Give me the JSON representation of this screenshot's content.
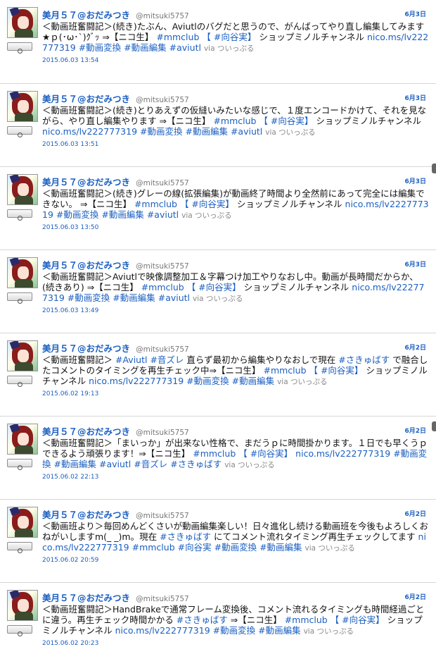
{
  "timeline": {
    "tweets": [
      {
        "name": "美月５７@おだみつき",
        "handle": "@mitsuki5757",
        "date": "6月3日",
        "timestamp": "2015.06.03 13:54",
        "text": "＜動画班奮闘記＞(続き)たぶん、Aviutlのバグだと思うので、がんばってやり直し編集してみます★ｐ(･ω･`)ｸﾞｯ ⇒【ニコ生】",
        "links": [
          "#mmclub",
          "【 #向谷実】"
        ],
        "text2": "ショップミノルチャンネル",
        "links2": [
          "nico.ms/lv222777319",
          "#動画変換",
          "#動画編集",
          "#aviutl"
        ],
        "via": "via ついっぷる"
      },
      {
        "name": "美月５７@おだみつき",
        "handle": "@mitsuki5757",
        "date": "6月3日",
        "timestamp": "2015.06.03 13:51",
        "text": "＜動画班奮闘記＞(続き)とりあえずの仮縫いみたいな感じで、１度エンコードかけて、それを見ながら、やり直し編集やります ⇒【ニコ生】",
        "links": [
          "#mmclub",
          "【 #向谷実】"
        ],
        "text2": "ショップミノルチャンネル",
        "links2": [
          "nico.ms/lv222777319",
          "#動画変換",
          "#動画編集",
          "#aviutl"
        ],
        "via": "via ついっぷる"
      },
      {
        "name": "美月５７@おだみつき",
        "handle": "@mitsuki5757",
        "date": "6月3日",
        "timestamp": "2015.06.03 13:50",
        "text": "＜動画班奮闘記＞(続き)グレーの線(拡張編集)が動画終了時間より全然前にあって完全には編集できない。 ⇒【ニコ生】",
        "links": [
          "#mmclub",
          "【 #向谷実】"
        ],
        "text2": "ショップミノルチャンネル",
        "links2": [
          "nico.ms/lv222777319",
          "#動画変換",
          "#動画編集",
          "#aviutl"
        ],
        "via": "via ついっぷる"
      },
      {
        "name": "美月５７@おだみつき",
        "handle": "@mitsuki5757",
        "date": "6月3日",
        "timestamp": "2015.06.03 13:49",
        "text": "＜動画班奮闘記＞Aviutlで映像調整加工＆字幕つけ加工やりなおし中。動画が長時間だからか、(続きあり) ⇒【ニコ生】",
        "links": [
          "#mmclub",
          "【 #向谷実】"
        ],
        "text2": "ショップミノルチャンネル",
        "links2": [
          "nico.ms/lv222777319",
          "#動画変換",
          "#動画編集",
          "#aviutl"
        ],
        "via": "via ついっぷる"
      },
      {
        "name": "美月５７@おだみつき",
        "handle": "@mitsuki5757",
        "date": "6月2日",
        "timestamp": "2015.06.02 19:13",
        "text": "＜動画班奮闘記＞",
        "links": [
          "#Aviutl",
          "#音ズレ"
        ],
        "text2": "直らず最初から編集やりなおしで現在",
        "links2": [
          "#さきゅばす"
        ],
        "text3": "で融合したコメントのタイミングを再生チェック中⇒【ニコ生】",
        "links3": [
          "#mmclub",
          "【 #向谷実】"
        ],
        "text4": "ショップミノルチャンネル",
        "links4": [
          "nico.ms/lv222777319",
          "#動画変換",
          "#動画編集"
        ],
        "via": "via ついっぷる"
      },
      {
        "name": "美月５７@おだみつき",
        "handle": "@mitsuki5757",
        "date": "6月2日",
        "timestamp": "2015.06.02 22:13",
        "text": "＜動画班奮闘記＞「まいっか」が出来ない性格で、まだうｐに時間掛かります。１日でも早くうｐできるよう頑張ります！⇒【ニコ生】",
        "links": [
          "#mmclub",
          "【 #向谷実】"
        ],
        "text2": "",
        "links2": [
          "nico.ms/lv222777319",
          "#動画変換",
          "#動画編集",
          "#aviutl",
          "#音ズレ",
          "#さきゅばす"
        ],
        "via": "via ついっぷる"
      },
      {
        "name": "美月５７@おだみつき",
        "handle": "@mitsuki5757",
        "date": "6月2日",
        "timestamp": "2015.06.02 20:59",
        "text": "＜動画班より＞毎回めんどくさいが動画編集楽しい！日々進化し続ける動画班を今後もよろしくおねがいしますm(_ _)m。現在",
        "links": [
          "#さきゅばす"
        ],
        "text2": "にてコメント流れタイミング再生チェックしてます",
        "links2": [
          "nico.ms/lv222777319",
          "#mmclub",
          "#向谷実",
          "#動画変換",
          "#動画編集"
        ],
        "via": "via ついっぷる"
      },
      {
        "name": "美月５７@おだみつき",
        "handle": "@mitsuki5757",
        "date": "6月2日",
        "timestamp": "2015.06.02 20:23",
        "text": "＜動画班奮闘記＞HandBrakeで通常フレーム変換後、コメント流れるタイミングも時間経過ごとに違う。再生チェック時間かかる",
        "links": [
          "#さきゅばす"
        ],
        "text2": "⇒【ニコ生】",
        "links2": [
          "#mmclub",
          "【 #向谷実】"
        ],
        "text3": "ショップミノルチャンネル",
        "links3": [
          "nico.ms/lv222777319",
          "#動画変換",
          "#動画編集"
        ],
        "via": "via ついっぷる"
      }
    ]
  }
}
